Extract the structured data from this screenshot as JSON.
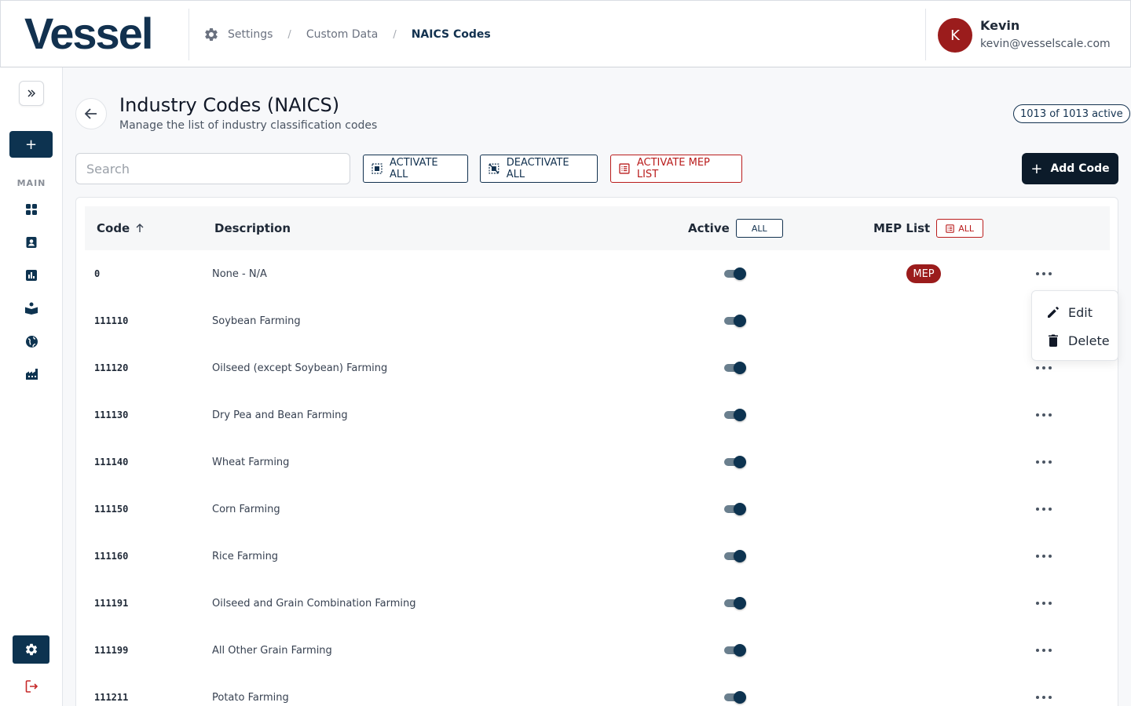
{
  "header": {
    "logo": "Vessel",
    "breadcrumbs": [
      "Settings",
      "Custom Data",
      "NAICS Codes"
    ],
    "user": {
      "initial": "K",
      "name": "Kevin",
      "email": "kevin@vesselscale.com"
    }
  },
  "sidebar": {
    "new_label": "+",
    "section_label": "MAIN",
    "nav_icons": [
      "dashboard-icon",
      "contacts-icon",
      "reports-icon",
      "learning-icon",
      "globe-icon",
      "factory-icon"
    ],
    "settings_icon": "gear-icon",
    "logout_icon": "logout-icon"
  },
  "page": {
    "title": "Industry Codes (NAICS)",
    "subtitle": "Manage the list of industry classification codes",
    "active_count": "1013 of 1013 active"
  },
  "toolbar": {
    "search_placeholder": "Search",
    "activate_all": "ACTIVATE ALL",
    "deactivate_all": "DEACTIVATE ALL",
    "activate_mep": "ACTIVATE MEP LIST",
    "add_code": "Add Code"
  },
  "table": {
    "headers": {
      "code": "Code",
      "description": "Description",
      "active": "Active",
      "mep": "MEP List"
    },
    "active_filter": "ALL",
    "mep_filter": "ALL",
    "mep_badge": "MEP",
    "rows": [
      {
        "code": "0",
        "description": "None - N/A",
        "active": true,
        "mep": true
      },
      {
        "code": "111110",
        "description": "Soybean Farming",
        "active": true,
        "mep": false
      },
      {
        "code": "111120",
        "description": "Oilseed (except Soybean) Farming",
        "active": true,
        "mep": false
      },
      {
        "code": "111130",
        "description": "Dry Pea and Bean Farming",
        "active": true,
        "mep": false
      },
      {
        "code": "111140",
        "description": "Wheat Farming",
        "active": true,
        "mep": false
      },
      {
        "code": "111150",
        "description": "Corn Farming",
        "active": true,
        "mep": false
      },
      {
        "code": "111160",
        "description": "Rice Farming",
        "active": true,
        "mep": false
      },
      {
        "code": "111191",
        "description": "Oilseed and Grain Combination Farming",
        "active": true,
        "mep": false
      },
      {
        "code": "111199",
        "description": "All Other Grain Farming",
        "active": true,
        "mep": false
      },
      {
        "code": "111211",
        "description": "Potato Farming",
        "active": true,
        "mep": false
      }
    ]
  },
  "row_menu": {
    "edit": "Edit",
    "delete": "Delete"
  },
  "colors": {
    "brand": "#12314f",
    "accent_dark": "#0d3350",
    "danger": "#9b1c1c"
  }
}
